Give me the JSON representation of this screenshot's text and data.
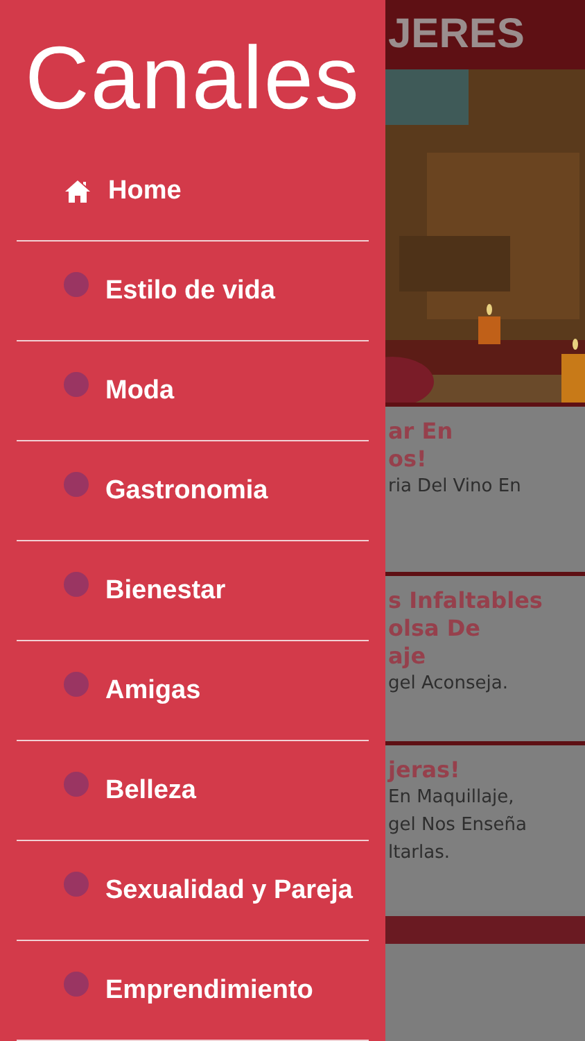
{
  "background": {
    "header_title": "JERES",
    "cards": [
      {
        "title_lines": [
          "ar En",
          "os!"
        ],
        "text_lines": [
          "ria Del Vino En"
        ]
      },
      {
        "title_lines": [
          "s Infaltables",
          "olsa De",
          "aje"
        ],
        "text_lines": [
          "gel Aconseja."
        ]
      },
      {
        "title_lines": [
          "jeras!"
        ],
        "text_lines": [
          "En Maquillaje,",
          "gel Nos Enseña",
          "ltarlas."
        ]
      }
    ]
  },
  "drawer": {
    "title": "Canales",
    "items": [
      {
        "kind": "home",
        "label": "Home"
      },
      {
        "kind": "channel",
        "label": "Estilo de vida"
      },
      {
        "kind": "channel",
        "label": "Moda"
      },
      {
        "kind": "channel",
        "label": "Gastronomia"
      },
      {
        "kind": "channel",
        "label": "Bienestar"
      },
      {
        "kind": "channel",
        "label": "Amigas"
      },
      {
        "kind": "channel",
        "label": "Belleza"
      },
      {
        "kind": "channel",
        "label": "Sexualidad y Pareja"
      },
      {
        "kind": "channel",
        "label": "Emprendimiento"
      }
    ]
  }
}
